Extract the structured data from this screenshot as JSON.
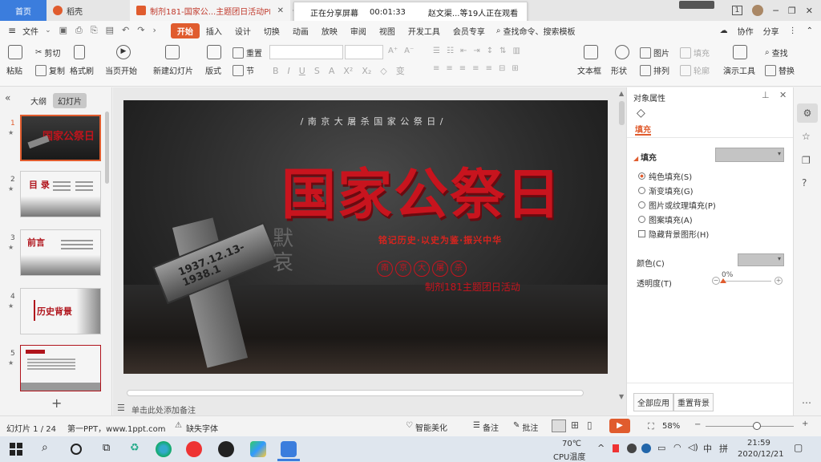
{
  "titlebar": {
    "home_tab": "首页",
    "wps_tab": "稻壳",
    "doc_tab": "制剂181-国家公...主题团日活动PPT",
    "close_glyph": "✕",
    "share_status": "正在分享屏幕",
    "share_time": "00:01:33",
    "share_viewers": "赵文渠...等19人正在观看",
    "window_badge": "1",
    "accent_color": "#3b7ddd"
  },
  "menubar": {
    "items": [
      "文件",
      "开始",
      "插入",
      "设计",
      "切换",
      "动画",
      "放映",
      "审阅",
      "视图",
      "开发工具",
      "会员专享"
    ],
    "active": "开始",
    "search_placeholder": "查找命令、搜索模板",
    "unsaved": "未同步",
    "collab": "协作",
    "share": "分享"
  },
  "ribbon": {
    "paste": "粘贴",
    "cut": "剪切",
    "copy": "复制",
    "format_painter": "格式刷",
    "play_from_current": "当页开始",
    "new_slide": "新建幻灯片",
    "layout": "版式",
    "section": "节",
    "reset": "重置",
    "textbox": "文本框",
    "shape": "形状",
    "image": "图片",
    "arrange": "排列",
    "fill": "填充",
    "outline": "轮廓",
    "presentation_tool": "演示工具",
    "find": "查找",
    "replace": "替换"
  },
  "leftpanel": {
    "tab_outline": "大纲",
    "tab_slides": "幻灯片",
    "slides": [
      {
        "num": "1",
        "title": "国家公祭日"
      },
      {
        "num": "2",
        "title": "目 录"
      },
      {
        "num": "3",
        "title": "前言"
      },
      {
        "num": "4",
        "title": "历史背景"
      },
      {
        "num": "5",
        "title": ""
      }
    ],
    "add_slide": "+",
    "notes_placeholder": "单击此处添加备注"
  },
  "slide": {
    "top_banner": "/ 南 京 大 屠 杀 国 家 公 祭 日 /",
    "main_title": "国家公祭日",
    "slogan": "铭记历史·以史为鉴·振兴中华",
    "circle_chars": [
      "南",
      "京",
      "大",
      "屠",
      "杀"
    ],
    "subtitle": "制剂181主题团日活动",
    "memorial_text": "1937.12.13-1938.1",
    "vertical_text": "默哀"
  },
  "rightpanel": {
    "title": "对象属性",
    "tab_fill": "填充",
    "section_fill": "填充",
    "options": [
      "纯色填充(S)",
      "渐变填充(G)",
      "图片或纹理填充(P)",
      "图案填充(A)"
    ],
    "checkbox": "隐藏背景图形(H)",
    "color_label": "颜色(C)",
    "transparency_label": "透明度(T)",
    "transparency_value": "0%",
    "transparency_fraction": 0,
    "apply_all": "全部应用",
    "reset_bg": "重置背景"
  },
  "statusbar": {
    "slide_info": "幻灯片 1 / 24",
    "theme": "第一PPT，www.1ppt.com",
    "missing_font": "缺失字体",
    "beautify": "智能美化",
    "notes": "备注",
    "comments": "批注",
    "zoom": "58%",
    "zoom_fraction": 0.58
  },
  "taskbar": {
    "temperature": "70℃",
    "cpu_label": "CPU温度",
    "ime": "中",
    "ime2": "拼",
    "time": "21:59",
    "date": "2020/12/21"
  }
}
